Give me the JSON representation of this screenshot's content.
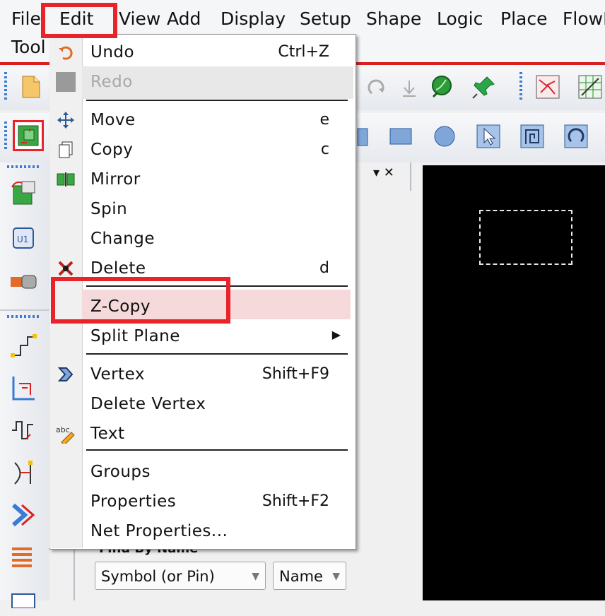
{
  "menubar": {
    "row1": [
      "File",
      "Edit",
      "View",
      "Add",
      "Display",
      "Setup",
      "Shape",
      "Logic",
      "Place",
      "FlowR"
    ],
    "row2": [
      "Tool"
    ]
  },
  "edit_menu": {
    "items": [
      {
        "label": "Undo",
        "shortcut": "Ctrl+Z",
        "icon": "undo-icon",
        "enabled": true
      },
      {
        "label": "Redo",
        "shortcut": "",
        "icon": "redo-icon",
        "enabled": false
      },
      {
        "label": "Move",
        "shortcut": "e",
        "icon": "move-icon",
        "enabled": true
      },
      {
        "label": "Copy",
        "shortcut": "c",
        "icon": "copy-icon",
        "enabled": true
      },
      {
        "label": "Mirror",
        "shortcut": "",
        "icon": "mirror-icon",
        "enabled": true
      },
      {
        "label": "Spin",
        "shortcut": "",
        "icon": "",
        "enabled": true
      },
      {
        "label": "Change",
        "shortcut": "",
        "icon": "",
        "enabled": true
      },
      {
        "label": "Delete",
        "shortcut": "d",
        "icon": "delete-icon",
        "enabled": true
      },
      {
        "label": "Z-Copy",
        "shortcut": "",
        "icon": "",
        "enabled": true,
        "highlighted": true
      },
      {
        "label": "Split Plane",
        "shortcut": "",
        "icon": "",
        "enabled": true,
        "submenu": true
      },
      {
        "label": "Vertex",
        "shortcut": "Shift+F9",
        "icon": "vertex-icon",
        "enabled": true
      },
      {
        "label": "Delete Vertex",
        "shortcut": "",
        "icon": "",
        "enabled": true
      },
      {
        "label": "Text",
        "shortcut": "",
        "icon": "text-icon",
        "enabled": true
      },
      {
        "label": "Groups",
        "shortcut": "",
        "icon": "",
        "enabled": true
      },
      {
        "label": "Properties",
        "shortcut": "Shift+F2",
        "icon": "",
        "enabled": true
      },
      {
        "label": "Net Properties...",
        "shortcut": "",
        "icon": "",
        "enabled": true
      }
    ],
    "submenu_arrow": "▶"
  },
  "panel": {
    "header_controls": "▾ ✕",
    "find_by_label": "Find By Name",
    "find_type": "Symbol (or Pin)",
    "find_field": "Name"
  },
  "colors": {
    "highlight_box": "#e8232a",
    "menu_highlight": "#f6d9da",
    "accent_line": "#d81e1e"
  }
}
